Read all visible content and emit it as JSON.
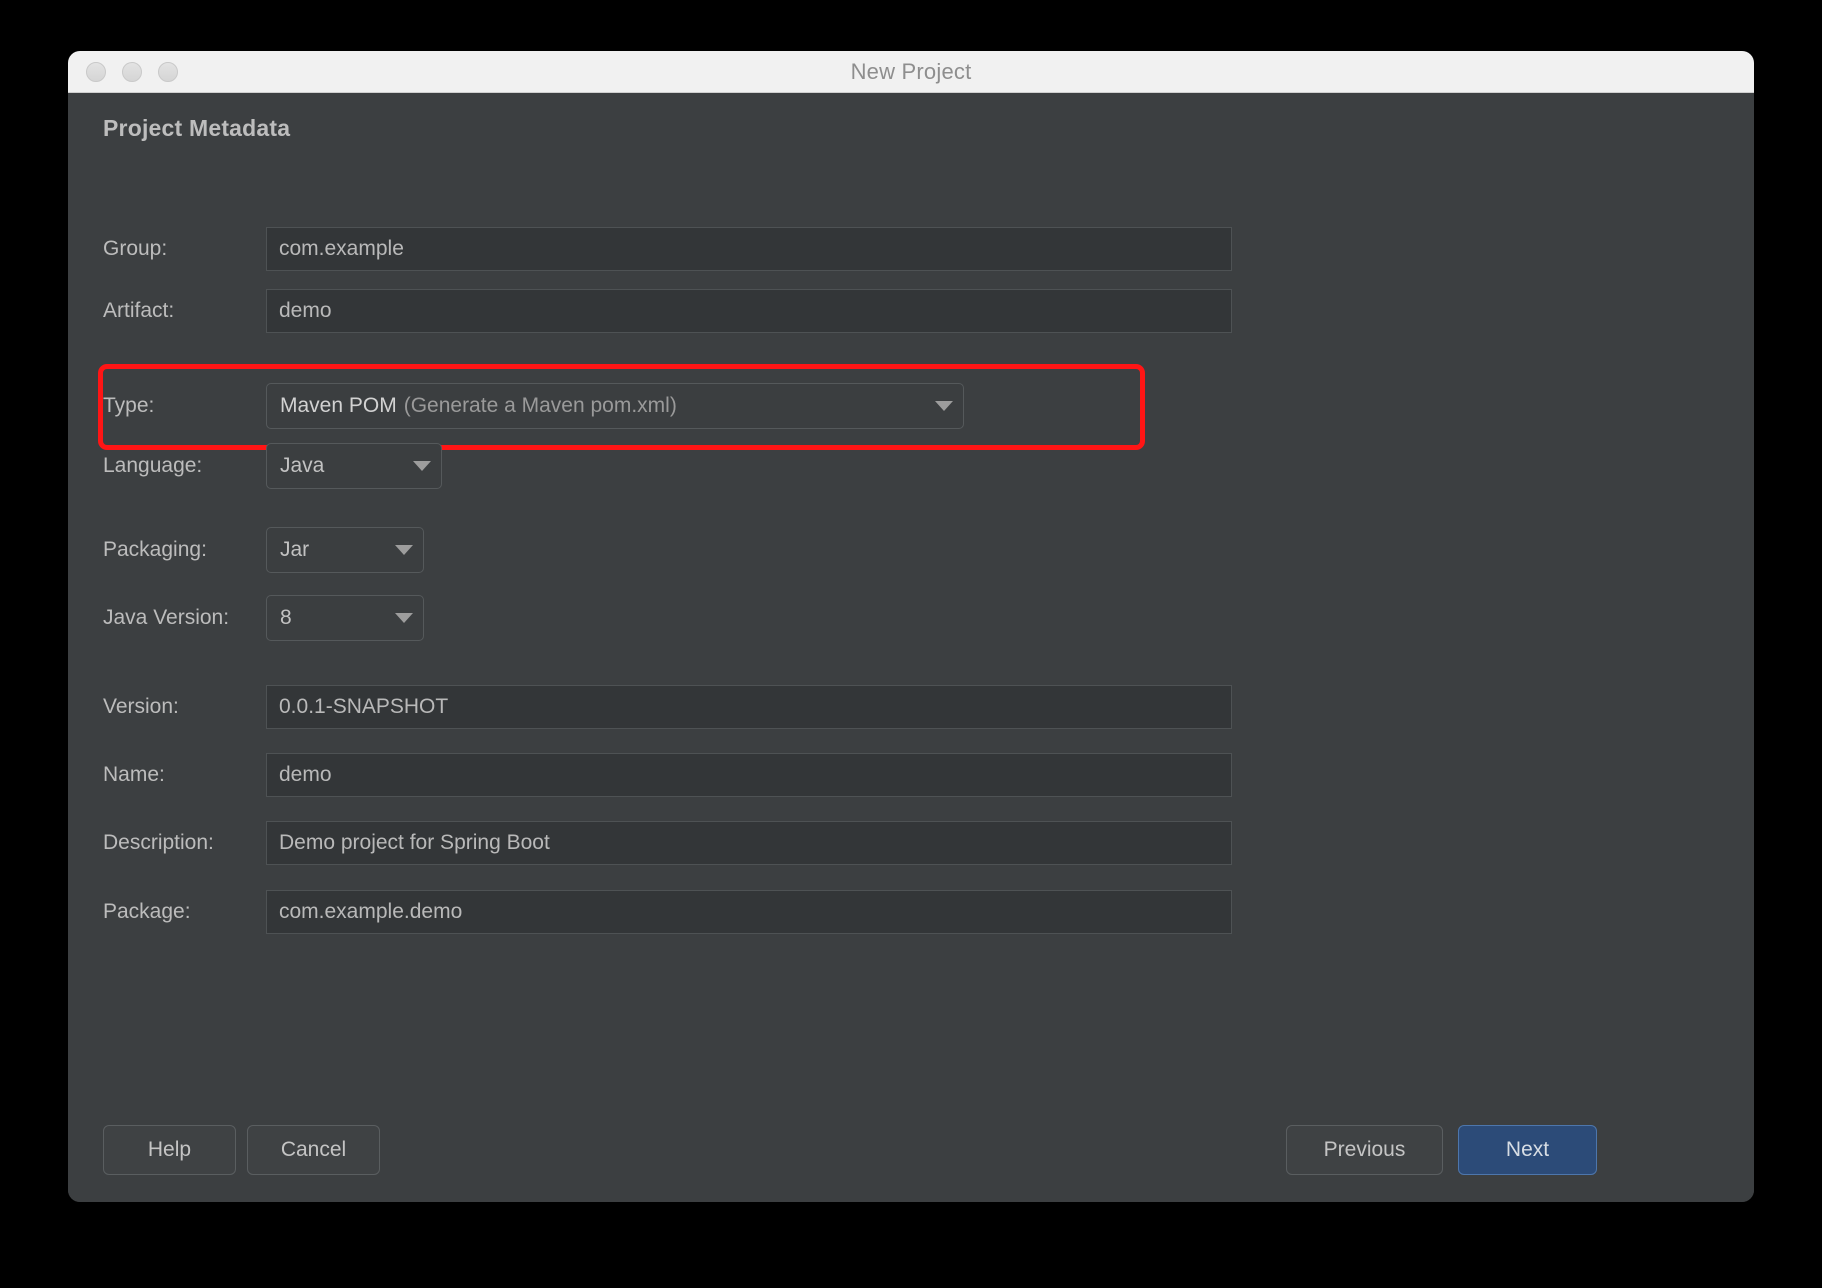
{
  "window": {
    "title": "New Project",
    "traffic_lights": [
      "close",
      "minimize",
      "zoom"
    ]
  },
  "section": {
    "title": "Project Metadata"
  },
  "accent_colors": {
    "highlight_box": "#ff1515",
    "primary_button": "#2c4b78",
    "dialog_bg": "#3c3f41",
    "titlebar_bg": "#f1f1f1"
  },
  "fields": {
    "group": {
      "label": "Group:",
      "value": "com.example"
    },
    "artifact": {
      "label": "Artifact:",
      "value": "demo"
    },
    "type": {
      "label": "Type:",
      "value_primary": "Maven POM",
      "value_secondary": "(Generate a Maven pom.xml)",
      "highlighted": true
    },
    "language": {
      "label": "Language:",
      "value": "Java"
    },
    "packaging": {
      "label": "Packaging:",
      "value": "Jar"
    },
    "java_version": {
      "label": "Java Version:",
      "value": "8"
    },
    "version": {
      "label": "Version:",
      "value": "0.0.1-SNAPSHOT"
    },
    "name": {
      "label": "Name:",
      "value": "demo"
    },
    "description": {
      "label": "Description:",
      "value": "Demo project for Spring Boot"
    },
    "package": {
      "label": "Package:",
      "value": "com.example.demo"
    }
  },
  "footer": {
    "help": "Help",
    "cancel": "Cancel",
    "previous": "Previous",
    "next": "Next"
  }
}
